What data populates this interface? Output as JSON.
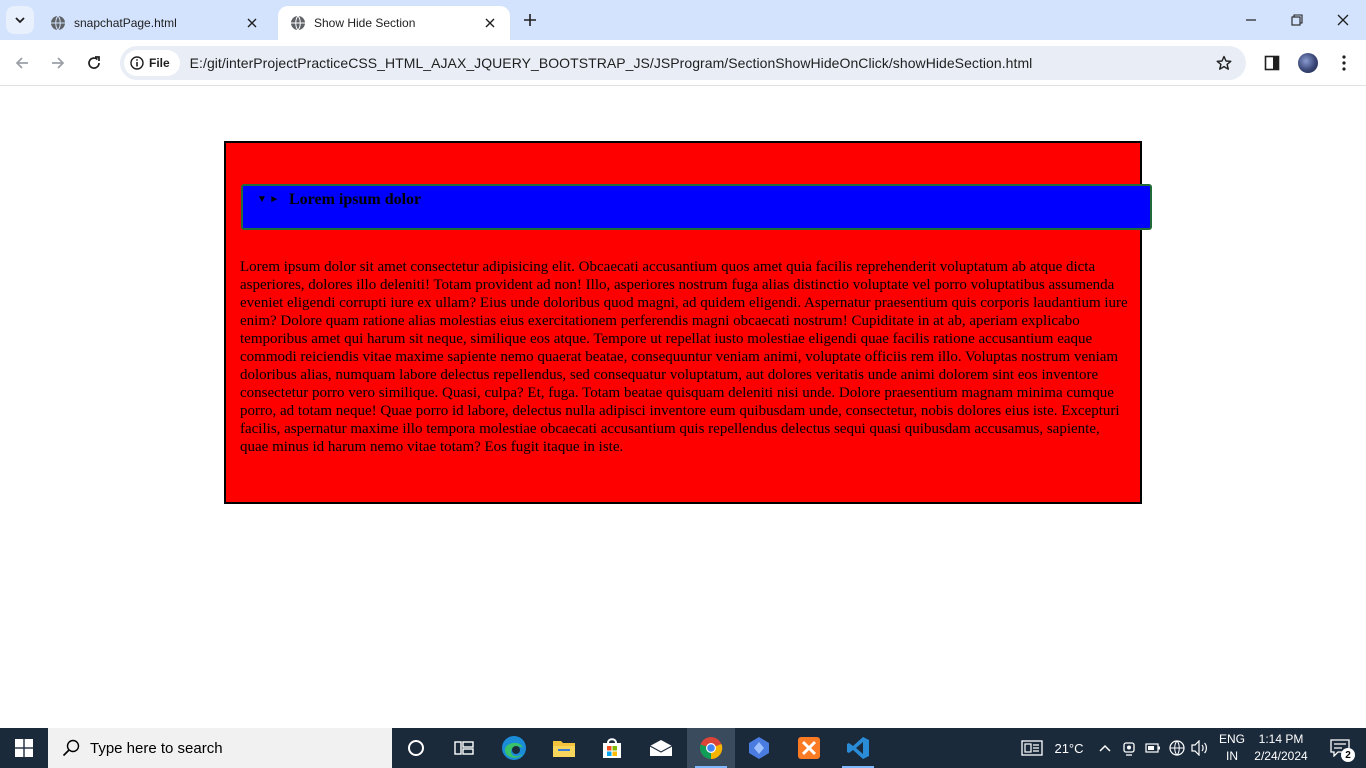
{
  "browser": {
    "tabs": [
      {
        "title": "snapchatPage.html",
        "active": false
      },
      {
        "title": "Show Hide Section",
        "active": true
      }
    ],
    "address": {
      "site_chip": "File",
      "url": "E:/git/interProjectPracticeCSS_HTML_AJAX_JQUERY_BOOTSTRAP_JS/JSProgram/SectionShowHideOnClick/showHideSection.html"
    }
  },
  "page": {
    "summary_markers": "▼ ►",
    "summary_label": "Lorem ipsum dolor",
    "paragraph": "Lorem ipsum dolor sit amet consectetur adipisicing elit. Obcaecati accusantium quos amet quia facilis reprehenderit voluptatum ab atque dicta asperiores, dolores illo deleniti! Totam provident ad non! Illo, asperiores nostrum fuga alias distinctio voluptate vel porro voluptatibus assumenda eveniet eligendi corrupti iure ex ullam? Eius unde doloribus quod magni, ad quidem eligendi. Aspernatur praesentium quis corporis laudantium iure enim? Dolore quam ratione alias molestias eius exercitationem perferendis magni obcaecati nostrum! Cupiditate in at ab, aperiam explicabo temporibus amet qui harum sit neque, similique eos atque. Tempore ut repellat iusto molestiae eligendi quae facilis ratione accusantium eaque commodi reiciendis vitae maxime sapiente nemo quaerat beatae, consequuntur veniam animi, voluptate officiis rem illo. Voluptas nostrum veniam doloribus alias, numquam labore delectus repellendus, sed consequatur voluptatum, aut dolores veritatis unde animi dolorem sint eos inventore consectetur porro vero similique. Quasi, culpa? Et, fuga. Totam beatae quisquam deleniti nisi unde. Dolore praesentium magnam minima cumque porro, ad totam neque! Quae porro id labore, delectus nulla adipisci inventore eum quibusdam unde, consectetur, nobis dolores eius iste. Excepturi facilis, aspernatur maxime illo tempora molestiae obcaecati accusantium quis repellendus delectus sequi quasi quibusdam accusamus, sapiente, quae minus id harum nemo vitae totam? Eos fugit itaque in iste.",
    "colors": {
      "container_bg": "#ff0000",
      "summary_bg": "#0000ff",
      "summary_border": "#1f6b3a"
    }
  },
  "taskbar": {
    "search_placeholder": "Type here to search",
    "weather": "21°C",
    "lang_line1": "ENG",
    "lang_line2": "IN",
    "time": "1:14 PM",
    "date": "2/24/2024",
    "notification_count": "2",
    "apps": [
      "cortana-icon",
      "task-view-icon",
      "edge-icon",
      "file-explorer-icon",
      "microsoft-store-icon",
      "mail-icon",
      "chrome-icon",
      "power-automate-icon",
      "xampp-icon",
      "vscode-icon"
    ]
  }
}
